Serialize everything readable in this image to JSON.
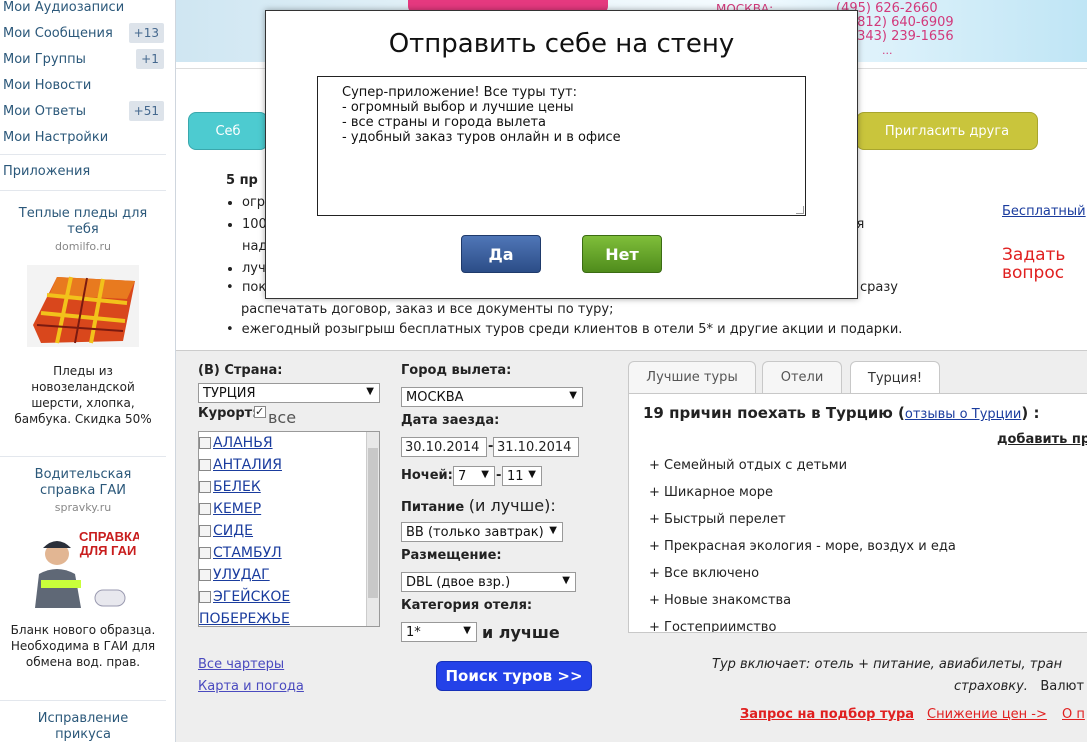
{
  "sidebar": {
    "menu": [
      {
        "label": "Мои Аудиозаписи",
        "badge": ""
      },
      {
        "label": "Мои Сообщения",
        "badge": "+13"
      },
      {
        "label": "Мои Группы",
        "badge": "+1"
      },
      {
        "label": "Мои Новости",
        "badge": ""
      },
      {
        "label": "Мои Ответы",
        "badge": "+51"
      },
      {
        "label": "Мои Настройки",
        "badge": ""
      }
    ],
    "apps_label": "Приложения",
    "ads": [
      {
        "title": "Теплые пледы для тебя",
        "domain": "domilfo.ru",
        "text": "Пледы из новозеландской шерсти, хлопка, бамбука. Скидка 50%"
      },
      {
        "title": "Водительская справка ГАИ",
        "domain": "spravky.ru",
        "img_text": "СПРАВКА ДЛЯ ГАИ",
        "text": "Бланк нового образца. Необходима в ГАИ для обмена вод. прав."
      },
      {
        "title": "Исправление прикуса"
      }
    ]
  },
  "banner": {
    "city": "МОСКВА:",
    "phones": [
      "(495) 626-2660",
      "(812) 640-6909",
      "(343) 239-1656",
      "..."
    ]
  },
  "pills": {
    "left_label": "Себ",
    "right_label": "Пригласить друга"
  },
  "right_links": {
    "free": "Бесплатный",
    "ask": "Задать вопрос"
  },
  "promo": {
    "heading": "5 пр",
    "bullets": [
      "огр",
      "100",
      "над",
      "луч",
      "пок"
    ],
    "line_ia": "ия",
    "line_srazu": "сразу",
    "line_print": "распечатать договор, заказ и все документы по туру;",
    "last": "ежегодный розыгрыш бесплатных туров среди клиентов в отели 5* и другие акции и подарки."
  },
  "search": {
    "country_label": "(В) Страна:",
    "country_value": "ТУРЦИЯ",
    "resort_label": "Курорт:",
    "resort_all": "все",
    "resorts": [
      "АЛАНЬЯ",
      "АНТАЛИЯ",
      "БЕЛЕК",
      "КЕМЕР",
      "СИДЕ",
      "СТАМБУЛ",
      "УЛУДАГ",
      "ЭГЕЙСКОЕ",
      "ПОБЕРЕЖЬЕ"
    ],
    "departure_label": "Город вылета:",
    "departure_value": "МОСКВА",
    "date_label": "Дата заезда:",
    "date_from": "30.10.2014",
    "date_to": "31.10.2014",
    "date_dash": "-",
    "nights_label": "Ночей:",
    "nights_from": "7",
    "nights_to": "11",
    "meal_label_bold": "Питание",
    "meal_label_rest": "(и лучше):",
    "meal_value": "BB (только завтрак)",
    "room_label": "Размещение:",
    "room_value": "DBL (двое взр.)",
    "cat_label": "Категория отеля:",
    "cat_value": "1*",
    "cat_suffix": "и лучше",
    "charters_link": "Все чартеры",
    "weather_link": "Карта и погода",
    "search_button": "Поиск туров >>"
  },
  "tabs": {
    "items": [
      "Лучшие туры",
      "Отели",
      "Турция!"
    ],
    "title_main": "19 причин поехать в Турцию (",
    "title_link": "отзывы о Турции",
    "title_end": ") :",
    "add": "добавить пр",
    "reasons": [
      "+ Семейный отдых с детьми",
      "+ Шикарное море",
      "+ Быстрый перелет",
      "+ Прекрасная экология - море, воздух и еда",
      "+ Все включено",
      "+ Новые знакомства",
      "+ Гостеприимство"
    ]
  },
  "tour_includes": {
    "line1": "Тур включает: отель + питание, авиабилеты, тран",
    "line2_italic": "страховку.",
    "line2_rest": "Валют"
  },
  "bottom_links": [
    "Запрос на подбор тура",
    "Снижение цен ->",
    "О п"
  ],
  "modal": {
    "title": "Отправить себе на стену",
    "text": "Супер-приложение! Все туры тут:\n- огромный выбор и лучшие цены\n- все страны и города вылета\n- удобный заказ туров онлайн и в офисе",
    "yes": "Да",
    "no": "Нет"
  },
  "colors": {
    "link": "#2b587a",
    "badge_bg": "#dde3ea",
    "teal": "#4dcbd0",
    "olive": "#c9c53c",
    "search_btn": "#2442e8",
    "yes_btn": "#2c4d87",
    "no_btn": "#4f8c1c",
    "red": "#e02020"
  }
}
